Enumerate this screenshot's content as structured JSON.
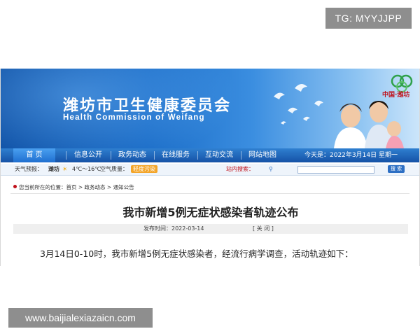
{
  "overlay": {
    "tg_label": "TG: MYYJJPP",
    "watermark": "www.baijialexiazaicn.com"
  },
  "banner": {
    "title_cn": "潍坊市卫生健康委员会",
    "title_en": "Health Commission of Weifang",
    "logo_text": "中国·潍坊",
    "colors": {
      "deep": "#0d4fa4",
      "light": "#cde6fb"
    }
  },
  "nav": {
    "items": [
      "首  页",
      "信息公开",
      "政务动态",
      "在线服务",
      "互动交流",
      "网站地图"
    ],
    "active_index": 0,
    "date": "今天是：2022年3月14日 星期一"
  },
  "infobar": {
    "weather_label": "天气预报：",
    "city": "潍坊",
    "temp": "4℃～16℃",
    "air_label": "空气质量：",
    "air_value": "轻度污染",
    "search_label": "站内搜索：",
    "search_button": "搜 索"
  },
  "breadcrumb": "您当前所在的位置：首页 > 政务动态 > 通知公告",
  "article": {
    "title": "我市新增5例无症状感染者轨迹公布",
    "publish_time": "发布时间：2022-03-14",
    "close_label": "[ 关 闭 ]",
    "first_line": "3月14日0-10时，我市新增5例无症状感染者，经流行病学调查，活动轨迹如下："
  }
}
